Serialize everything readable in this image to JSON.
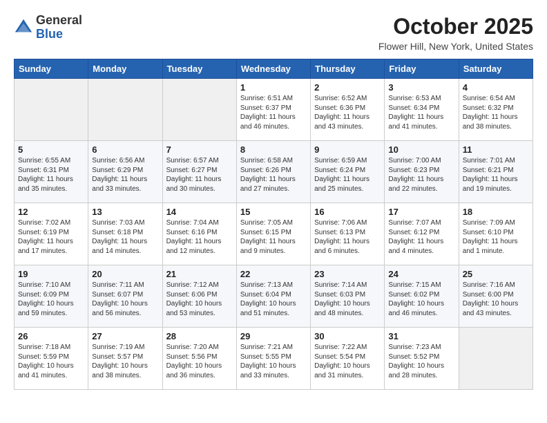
{
  "header": {
    "logo_general": "General",
    "logo_blue": "Blue",
    "month_title": "October 2025",
    "location": "Flower Hill, New York, United States"
  },
  "days_of_week": [
    "Sunday",
    "Monday",
    "Tuesday",
    "Wednesday",
    "Thursday",
    "Friday",
    "Saturday"
  ],
  "weeks": [
    [
      {
        "day": null,
        "info": null
      },
      {
        "day": null,
        "info": null
      },
      {
        "day": null,
        "info": null
      },
      {
        "day": "1",
        "info": "Sunrise: 6:51 AM\nSunset: 6:37 PM\nDaylight: 11 hours\nand 46 minutes."
      },
      {
        "day": "2",
        "info": "Sunrise: 6:52 AM\nSunset: 6:36 PM\nDaylight: 11 hours\nand 43 minutes."
      },
      {
        "day": "3",
        "info": "Sunrise: 6:53 AM\nSunset: 6:34 PM\nDaylight: 11 hours\nand 41 minutes."
      },
      {
        "day": "4",
        "info": "Sunrise: 6:54 AM\nSunset: 6:32 PM\nDaylight: 11 hours\nand 38 minutes."
      }
    ],
    [
      {
        "day": "5",
        "info": "Sunrise: 6:55 AM\nSunset: 6:31 PM\nDaylight: 11 hours\nand 35 minutes."
      },
      {
        "day": "6",
        "info": "Sunrise: 6:56 AM\nSunset: 6:29 PM\nDaylight: 11 hours\nand 33 minutes."
      },
      {
        "day": "7",
        "info": "Sunrise: 6:57 AM\nSunset: 6:27 PM\nDaylight: 11 hours\nand 30 minutes."
      },
      {
        "day": "8",
        "info": "Sunrise: 6:58 AM\nSunset: 6:26 PM\nDaylight: 11 hours\nand 27 minutes."
      },
      {
        "day": "9",
        "info": "Sunrise: 6:59 AM\nSunset: 6:24 PM\nDaylight: 11 hours\nand 25 minutes."
      },
      {
        "day": "10",
        "info": "Sunrise: 7:00 AM\nSunset: 6:23 PM\nDaylight: 11 hours\nand 22 minutes."
      },
      {
        "day": "11",
        "info": "Sunrise: 7:01 AM\nSunset: 6:21 PM\nDaylight: 11 hours\nand 19 minutes."
      }
    ],
    [
      {
        "day": "12",
        "info": "Sunrise: 7:02 AM\nSunset: 6:19 PM\nDaylight: 11 hours\nand 17 minutes."
      },
      {
        "day": "13",
        "info": "Sunrise: 7:03 AM\nSunset: 6:18 PM\nDaylight: 11 hours\nand 14 minutes."
      },
      {
        "day": "14",
        "info": "Sunrise: 7:04 AM\nSunset: 6:16 PM\nDaylight: 11 hours\nand 12 minutes."
      },
      {
        "day": "15",
        "info": "Sunrise: 7:05 AM\nSunset: 6:15 PM\nDaylight: 11 hours\nand 9 minutes."
      },
      {
        "day": "16",
        "info": "Sunrise: 7:06 AM\nSunset: 6:13 PM\nDaylight: 11 hours\nand 6 minutes."
      },
      {
        "day": "17",
        "info": "Sunrise: 7:07 AM\nSunset: 6:12 PM\nDaylight: 11 hours\nand 4 minutes."
      },
      {
        "day": "18",
        "info": "Sunrise: 7:09 AM\nSunset: 6:10 PM\nDaylight: 11 hours\nand 1 minute."
      }
    ],
    [
      {
        "day": "19",
        "info": "Sunrise: 7:10 AM\nSunset: 6:09 PM\nDaylight: 10 hours\nand 59 minutes."
      },
      {
        "day": "20",
        "info": "Sunrise: 7:11 AM\nSunset: 6:07 PM\nDaylight: 10 hours\nand 56 minutes."
      },
      {
        "day": "21",
        "info": "Sunrise: 7:12 AM\nSunset: 6:06 PM\nDaylight: 10 hours\nand 53 minutes."
      },
      {
        "day": "22",
        "info": "Sunrise: 7:13 AM\nSunset: 6:04 PM\nDaylight: 10 hours\nand 51 minutes."
      },
      {
        "day": "23",
        "info": "Sunrise: 7:14 AM\nSunset: 6:03 PM\nDaylight: 10 hours\nand 48 minutes."
      },
      {
        "day": "24",
        "info": "Sunrise: 7:15 AM\nSunset: 6:02 PM\nDaylight: 10 hours\nand 46 minutes."
      },
      {
        "day": "25",
        "info": "Sunrise: 7:16 AM\nSunset: 6:00 PM\nDaylight: 10 hours\nand 43 minutes."
      }
    ],
    [
      {
        "day": "26",
        "info": "Sunrise: 7:18 AM\nSunset: 5:59 PM\nDaylight: 10 hours\nand 41 minutes."
      },
      {
        "day": "27",
        "info": "Sunrise: 7:19 AM\nSunset: 5:57 PM\nDaylight: 10 hours\nand 38 minutes."
      },
      {
        "day": "28",
        "info": "Sunrise: 7:20 AM\nSunset: 5:56 PM\nDaylight: 10 hours\nand 36 minutes."
      },
      {
        "day": "29",
        "info": "Sunrise: 7:21 AM\nSunset: 5:55 PM\nDaylight: 10 hours\nand 33 minutes."
      },
      {
        "day": "30",
        "info": "Sunrise: 7:22 AM\nSunset: 5:54 PM\nDaylight: 10 hours\nand 31 minutes."
      },
      {
        "day": "31",
        "info": "Sunrise: 7:23 AM\nSunset: 5:52 PM\nDaylight: 10 hours\nand 28 minutes."
      },
      {
        "day": null,
        "info": null
      }
    ]
  ]
}
